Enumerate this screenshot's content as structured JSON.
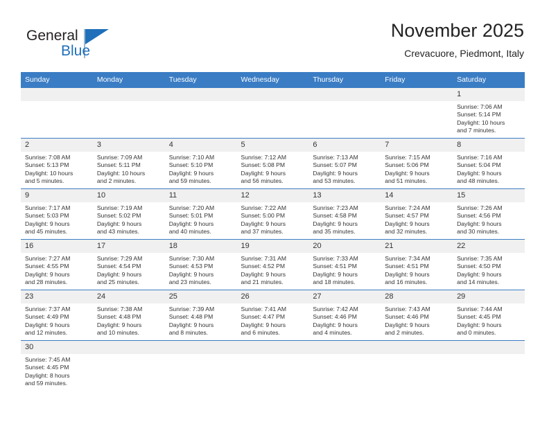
{
  "brand": {
    "name_top": "General",
    "name_bottom": "Blue",
    "accent_color": "#1f6fba",
    "flag_icon": "triangle-flag-icon"
  },
  "header": {
    "title": "November 2025",
    "subtitle": "Crevacuore, Piedmont, Italy"
  },
  "calendar": {
    "header_color": "#3b7dc4",
    "weekday_headers": [
      "Sunday",
      "Monday",
      "Tuesday",
      "Wednesday",
      "Thursday",
      "Friday",
      "Saturday"
    ],
    "weeks": [
      [
        {
          "day": "",
          "lines": []
        },
        {
          "day": "",
          "lines": []
        },
        {
          "day": "",
          "lines": []
        },
        {
          "day": "",
          "lines": []
        },
        {
          "day": "",
          "lines": []
        },
        {
          "day": "",
          "lines": []
        },
        {
          "day": "1",
          "lines": [
            "Sunrise: 7:06 AM",
            "Sunset: 5:14 PM",
            "Daylight: 10 hours",
            "and 7 minutes."
          ]
        }
      ],
      [
        {
          "day": "2",
          "lines": [
            "Sunrise: 7:08 AM",
            "Sunset: 5:13 PM",
            "Daylight: 10 hours",
            "and 5 minutes."
          ]
        },
        {
          "day": "3",
          "lines": [
            "Sunrise: 7:09 AM",
            "Sunset: 5:11 PM",
            "Daylight: 10 hours",
            "and 2 minutes."
          ]
        },
        {
          "day": "4",
          "lines": [
            "Sunrise: 7:10 AM",
            "Sunset: 5:10 PM",
            "Daylight: 9 hours",
            "and 59 minutes."
          ]
        },
        {
          "day": "5",
          "lines": [
            "Sunrise: 7:12 AM",
            "Sunset: 5:08 PM",
            "Daylight: 9 hours",
            "and 56 minutes."
          ]
        },
        {
          "day": "6",
          "lines": [
            "Sunrise: 7:13 AM",
            "Sunset: 5:07 PM",
            "Daylight: 9 hours",
            "and 53 minutes."
          ]
        },
        {
          "day": "7",
          "lines": [
            "Sunrise: 7:15 AM",
            "Sunset: 5:06 PM",
            "Daylight: 9 hours",
            "and 51 minutes."
          ]
        },
        {
          "day": "8",
          "lines": [
            "Sunrise: 7:16 AM",
            "Sunset: 5:04 PM",
            "Daylight: 9 hours",
            "and 48 minutes."
          ]
        }
      ],
      [
        {
          "day": "9",
          "lines": [
            "Sunrise: 7:17 AM",
            "Sunset: 5:03 PM",
            "Daylight: 9 hours",
            "and 45 minutes."
          ]
        },
        {
          "day": "10",
          "lines": [
            "Sunrise: 7:19 AM",
            "Sunset: 5:02 PM",
            "Daylight: 9 hours",
            "and 43 minutes."
          ]
        },
        {
          "day": "11",
          "lines": [
            "Sunrise: 7:20 AM",
            "Sunset: 5:01 PM",
            "Daylight: 9 hours",
            "and 40 minutes."
          ]
        },
        {
          "day": "12",
          "lines": [
            "Sunrise: 7:22 AM",
            "Sunset: 5:00 PM",
            "Daylight: 9 hours",
            "and 37 minutes."
          ]
        },
        {
          "day": "13",
          "lines": [
            "Sunrise: 7:23 AM",
            "Sunset: 4:58 PM",
            "Daylight: 9 hours",
            "and 35 minutes."
          ]
        },
        {
          "day": "14",
          "lines": [
            "Sunrise: 7:24 AM",
            "Sunset: 4:57 PM",
            "Daylight: 9 hours",
            "and 32 minutes."
          ]
        },
        {
          "day": "15",
          "lines": [
            "Sunrise: 7:26 AM",
            "Sunset: 4:56 PM",
            "Daylight: 9 hours",
            "and 30 minutes."
          ]
        }
      ],
      [
        {
          "day": "16",
          "lines": [
            "Sunrise: 7:27 AM",
            "Sunset: 4:55 PM",
            "Daylight: 9 hours",
            "and 28 minutes."
          ]
        },
        {
          "day": "17",
          "lines": [
            "Sunrise: 7:29 AM",
            "Sunset: 4:54 PM",
            "Daylight: 9 hours",
            "and 25 minutes."
          ]
        },
        {
          "day": "18",
          "lines": [
            "Sunrise: 7:30 AM",
            "Sunset: 4:53 PM",
            "Daylight: 9 hours",
            "and 23 minutes."
          ]
        },
        {
          "day": "19",
          "lines": [
            "Sunrise: 7:31 AM",
            "Sunset: 4:52 PM",
            "Daylight: 9 hours",
            "and 21 minutes."
          ]
        },
        {
          "day": "20",
          "lines": [
            "Sunrise: 7:33 AM",
            "Sunset: 4:51 PM",
            "Daylight: 9 hours",
            "and 18 minutes."
          ]
        },
        {
          "day": "21",
          "lines": [
            "Sunrise: 7:34 AM",
            "Sunset: 4:51 PM",
            "Daylight: 9 hours",
            "and 16 minutes."
          ]
        },
        {
          "day": "22",
          "lines": [
            "Sunrise: 7:35 AM",
            "Sunset: 4:50 PM",
            "Daylight: 9 hours",
            "and 14 minutes."
          ]
        }
      ],
      [
        {
          "day": "23",
          "lines": [
            "Sunrise: 7:37 AM",
            "Sunset: 4:49 PM",
            "Daylight: 9 hours",
            "and 12 minutes."
          ]
        },
        {
          "day": "24",
          "lines": [
            "Sunrise: 7:38 AM",
            "Sunset: 4:48 PM",
            "Daylight: 9 hours",
            "and 10 minutes."
          ]
        },
        {
          "day": "25",
          "lines": [
            "Sunrise: 7:39 AM",
            "Sunset: 4:48 PM",
            "Daylight: 9 hours",
            "and 8 minutes."
          ]
        },
        {
          "day": "26",
          "lines": [
            "Sunrise: 7:41 AM",
            "Sunset: 4:47 PM",
            "Daylight: 9 hours",
            "and 6 minutes."
          ]
        },
        {
          "day": "27",
          "lines": [
            "Sunrise: 7:42 AM",
            "Sunset: 4:46 PM",
            "Daylight: 9 hours",
            "and 4 minutes."
          ]
        },
        {
          "day": "28",
          "lines": [
            "Sunrise: 7:43 AM",
            "Sunset: 4:46 PM",
            "Daylight: 9 hours",
            "and 2 minutes."
          ]
        },
        {
          "day": "29",
          "lines": [
            "Sunrise: 7:44 AM",
            "Sunset: 4:45 PM",
            "Daylight: 9 hours",
            "and 0 minutes."
          ]
        }
      ],
      [
        {
          "day": "30",
          "lines": [
            "Sunrise: 7:45 AM",
            "Sunset: 4:45 PM",
            "Daylight: 8 hours",
            "and 59 minutes."
          ]
        },
        {
          "day": "",
          "lines": []
        },
        {
          "day": "",
          "lines": []
        },
        {
          "day": "",
          "lines": []
        },
        {
          "day": "",
          "lines": []
        },
        {
          "day": "",
          "lines": []
        },
        {
          "day": "",
          "lines": []
        }
      ]
    ]
  }
}
